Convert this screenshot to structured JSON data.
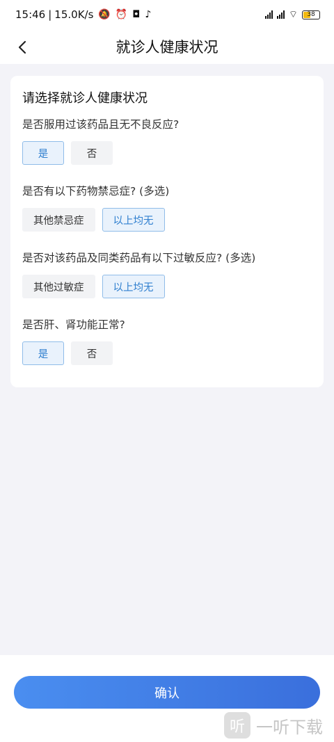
{
  "status_bar": {
    "time": "15:46",
    "speed": "15.0K/s",
    "battery": "38",
    "icons": [
      "bell-off-icon",
      "alarm-icon",
      "nfc-icon",
      "tiktok-icon",
      "signal-icon",
      "wifi-icon",
      "battery-icon"
    ]
  },
  "nav": {
    "title": "就诊人健康状况",
    "back_icon": "chevron-left-icon"
  },
  "card": {
    "title": "请选择就诊人健康状况",
    "questions": [
      {
        "text": "是否服用过该药品且无不良反应?",
        "options": [
          {
            "label": "是",
            "selected": true
          },
          {
            "label": "否",
            "selected": false
          }
        ]
      },
      {
        "text": "是否有以下药物禁忌症? (多选)",
        "options": [
          {
            "label": "其他禁忌症",
            "selected": false
          },
          {
            "label": "以上均无",
            "selected": true
          }
        ]
      },
      {
        "text": "是否对该药品及同类药品有以下过敏反应? (多选)",
        "options": [
          {
            "label": "其他过敏症",
            "selected": false
          },
          {
            "label": "以上均无",
            "selected": true
          }
        ]
      },
      {
        "text": "是否肝、肾功能正常?",
        "options": [
          {
            "label": "是",
            "selected": true
          },
          {
            "label": "否",
            "selected": false
          }
        ]
      }
    ]
  },
  "confirm_label": "确认",
  "watermark": {
    "logo_text": "听",
    "text": "一听下载"
  },
  "colors": {
    "accent": "#3a7fe4",
    "selected_bg": "#e9f2fc",
    "selected_text": "#2f7fcf",
    "page_bg": "#f3f3f8"
  }
}
